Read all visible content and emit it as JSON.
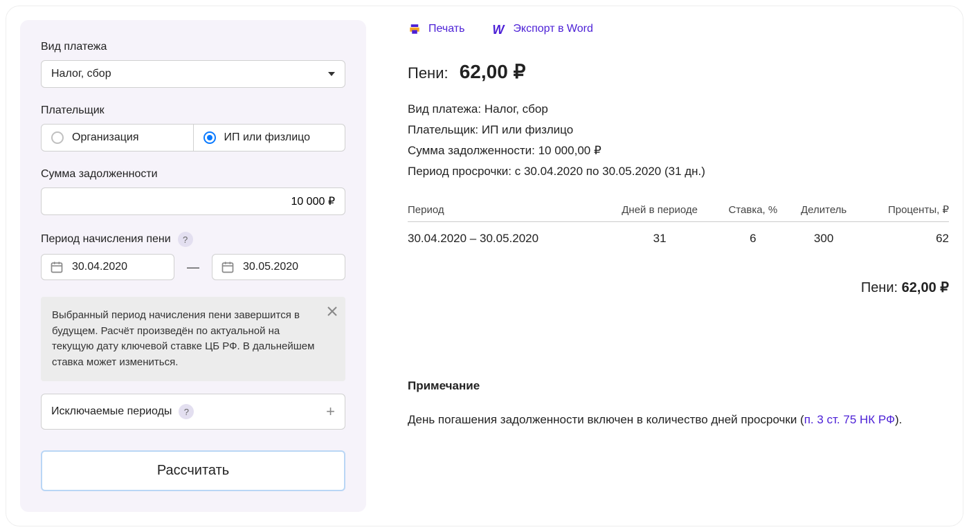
{
  "form": {
    "payment_type": {
      "label": "Вид платежа",
      "value": "Налог, сбор"
    },
    "payer": {
      "label": "Плательщик",
      "options": [
        {
          "label": "Организация",
          "selected": false
        },
        {
          "label": "ИП или физлицо",
          "selected": true
        }
      ]
    },
    "amount": {
      "label": "Сумма задолженности",
      "value": "10 000 ₽"
    },
    "period": {
      "label": "Период начисления пени",
      "from": "30.04.2020",
      "to": "30.05.2020",
      "dash": "—",
      "help": "?"
    },
    "warning": "Выбранный период начисления пени завершится в будущем. Расчёт произведён по актуальной на текущую дату ключевой ставке ЦБ РФ. В дальнейшем ставка может измениться.",
    "exclude": {
      "label": "Исключаемые периоды",
      "help": "?"
    },
    "calc_button": "Рассчитать"
  },
  "actions": {
    "print": "Печать",
    "export_word": "Экспорт в Word"
  },
  "result": {
    "title_label": "Пени:",
    "title_amount": "62,00 ₽",
    "meta": {
      "type": "Вид платежа: Налог, сбор",
      "payer": "Плательщик: ИП или физлицо",
      "amount": "Сумма задолженности: 10 000,00 ₽",
      "period": "Период просрочки: с 30.04.2020 по 30.05.2020 (31 дн.)"
    },
    "table": {
      "headers": {
        "period": "Период",
        "days": "Дней в периоде",
        "rate": "Ставка, %",
        "div": "Делитель",
        "int": "Проценты, ₽"
      },
      "row": {
        "period": "30.04.2020 – 30.05.2020",
        "days": "31",
        "rate": "6",
        "div": "300",
        "int": "62"
      }
    },
    "total": {
      "label": "Пени:",
      "amount": "62,00 ₽"
    },
    "note": {
      "title": "Примечание",
      "text_before": "День погашения задолженности включен в количество дней просрочки (",
      "link": "п. 3 ст. 75 НК РФ",
      "text_after": ")."
    }
  }
}
